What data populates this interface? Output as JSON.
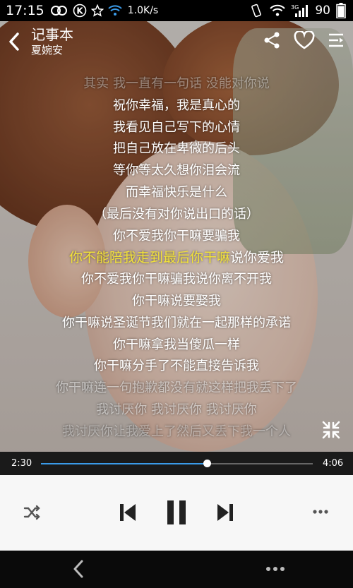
{
  "status_bar": {
    "time": "17:15",
    "speed": "1.0K/s",
    "battery": "90",
    "network": "3G",
    "icons": [
      "loop-icon",
      "k-icon",
      "star-icon",
      "wifi-icon",
      "vibrate-icon",
      "wifi-icon",
      "signal-icon"
    ]
  },
  "header": {
    "title": "记事本",
    "artist": "夏婉安",
    "icons": [
      "back-arrow-icon",
      "share-icon",
      "heart-icon",
      "menu-icon"
    ]
  },
  "lyrics": {
    "lines": [
      "其实 我一直有一句话 没能对你说",
      "祝你幸福，我是真心的",
      "我看见自己写下的心情",
      "把自己放在卑微的后头",
      "等你等太久想你泪会流",
      "而幸福快乐是什么",
      "（最后没有对你说出口的话）",
      "你不爱我你干嘛要骗我",
      "你不能陪我走到最后你干嘛说你爱我",
      "你不爱我你干嘛骗我说你离不开我",
      "你干嘛说要娶我",
      "你干嘛说圣诞节我们就在一起那样的承诺",
      "你干嘛拿我当傻瓜一样",
      "你干嘛分手了不能直接告诉我",
      "你干嘛连一句抱歉都没有就这样把我丢下了",
      "我讨厌你 我讨厌你 我讨厌你",
      "我讨厌你让我爱上了然后又丢下我一个人"
    ],
    "current_sung": "你不能陪我走到最后你干嘛",
    "current_rest": "说你爱我",
    "highlight_color": "#f2e23a"
  },
  "progress": {
    "current": "2:30",
    "total": "4:06",
    "fraction": 0.61,
    "accent": "#3a9ae8"
  },
  "controls": {
    "icons": [
      "shuffle-icon",
      "previous-icon",
      "pause-icon",
      "next-icon",
      "more-icon"
    ]
  },
  "nav": {
    "icons": [
      "back-icon",
      "more-icon"
    ]
  }
}
